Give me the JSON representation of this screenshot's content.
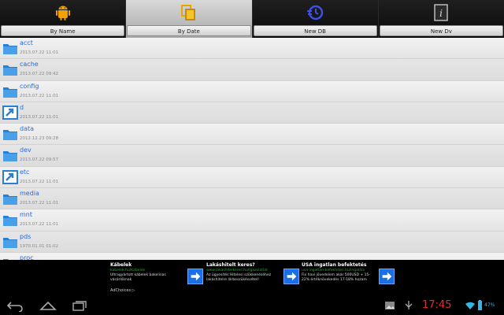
{
  "tabs": [
    {
      "label": "By Name",
      "icon": "android-icon",
      "active": false
    },
    {
      "label": "By Date",
      "icon": "copy-icon",
      "active": true
    },
    {
      "label": "New DB",
      "icon": "history-icon",
      "active": false
    },
    {
      "label": "New Dv",
      "icon": "info-icon",
      "active": false
    }
  ],
  "files": [
    {
      "name": "acct",
      "date": "2013.07.22 11:01",
      "type": "folder"
    },
    {
      "name": "cache",
      "date": "2013.07.22 09:42",
      "type": "folder"
    },
    {
      "name": "config",
      "date": "2013.07.22 11:01",
      "type": "folder"
    },
    {
      "name": "d",
      "date": "2013.07.22 11:01",
      "type": "link"
    },
    {
      "name": "data",
      "date": "2012.12.23 09:28",
      "type": "folder"
    },
    {
      "name": "dev",
      "date": "2013.07.22 09:57",
      "type": "folder"
    },
    {
      "name": "etc",
      "date": "2013.07.22 11:01",
      "type": "link"
    },
    {
      "name": "media",
      "date": "2013.07.22 11:01",
      "type": "folder"
    },
    {
      "name": "mnt",
      "date": "2013.07.22 11:01",
      "type": "folder"
    },
    {
      "name": "pds",
      "date": "1970.01.01 01:02",
      "type": "folder"
    },
    {
      "name": "proc",
      "date": "",
      "type": "folder"
    }
  ],
  "ads": [
    {
      "title": "Kábelek",
      "url": "kabelek.hu/Kabelek",
      "desc": "Ultragyártott kábelek bakelinas vásárlóknak"
    },
    {
      "title": "Lakáshitelt keres?",
      "url": "www.lakashitelkeres.hu/lgazolatlat",
      "desc": "Az ügyesítés Hitelesi szökkenéséhez lakáshitelre lărbeszükésvétel!"
    },
    {
      "title": "USA ingatlan befektetés",
      "url": "usa-ingatlan-befektetes.hu/ingatlan",
      "desc": "Fix havi jövedelem akár 500USD + 15-22% értéknövekedés 17-18% hozam"
    }
  ],
  "adchoices": "AdChoices ▷",
  "status": {
    "time": "17:45",
    "battery": "47%"
  },
  "colors": {
    "accent": "#2a6bd8",
    "clock": "#d6322b",
    "ad_button": "#1a6ee6"
  }
}
